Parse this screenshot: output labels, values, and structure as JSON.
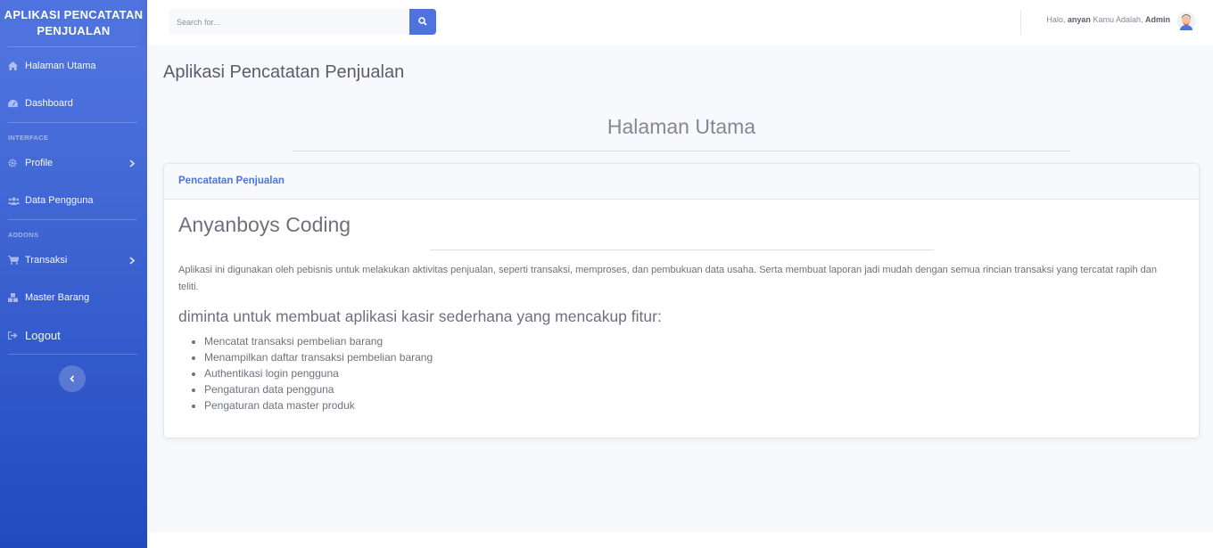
{
  "sidebar": {
    "brand": "APLIKASI PENCATATAN PENJUALAN",
    "items": [
      {
        "label": "Halaman Utama",
        "icon": "home-icon"
      },
      {
        "label": "Dashboard",
        "icon": "tachometer-icon"
      },
      {
        "label": "Profile",
        "icon": "cog-icon"
      },
      {
        "label": "Data Pengguna",
        "icon": "users-icon"
      },
      {
        "label": "Transaksi",
        "icon": "cart-icon"
      },
      {
        "label": "Master Barang",
        "icon": "boxes-icon"
      },
      {
        "label": "Logout",
        "icon": "logout-icon"
      }
    ],
    "headings": [
      "INTERFACE",
      "ADDONS"
    ]
  },
  "topbar": {
    "search_placeholder": "Search for...",
    "greeting_prefix": "Halo,",
    "username": "anyan",
    "role_prefix": "Kamu Adalah,",
    "role": "Admin"
  },
  "main": {
    "page_title": "Aplikasi Pencatatan Penjualan",
    "section_title": "Halaman Utama",
    "card": {
      "header": "Pencatatan Penjualan",
      "title": "Anyanboys Coding",
      "description": "Aplikasi ini digunakan oleh pebisnis untuk melakukan aktivitas penjualan, seperti transaksi, memproses, dan pembukuan data usaha. Serta membuat laporan jadi mudah dengan semua rincian transaksi yang tercatat rapih dan teliti.",
      "subheading": "diminta untuk membuat aplikasi kasir sederhana yang mencakup fitur:",
      "features": [
        "Mencatat transaksi pembelian barang",
        "Menampilkan daftar transaksi pembelian barang",
        "Authentikasi login pengguna",
        "Pengaturan data pengguna",
        "Pengaturan data master produk"
      ]
    }
  },
  "colors": {
    "primary": "#4e73df",
    "sidebar_bottom": "#224abe",
    "content_bg": "#f8f9fc",
    "text_gray": "#858796"
  }
}
